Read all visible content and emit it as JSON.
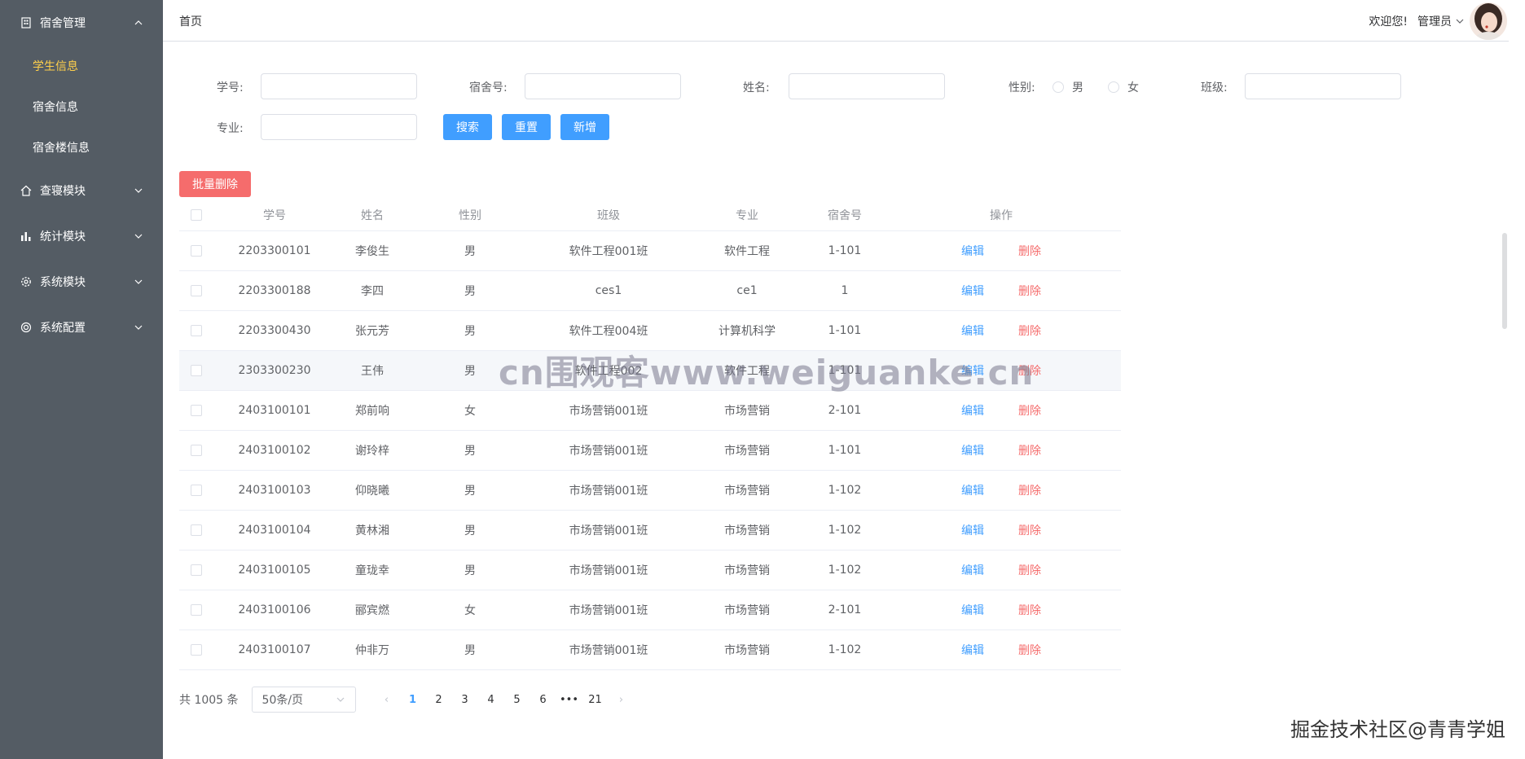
{
  "sidebar": {
    "groups": [
      {
        "label": "宿舍管理",
        "icon": "building-icon",
        "expanded": true,
        "children": [
          {
            "label": "学生信息",
            "active": true
          },
          {
            "label": "宿舍信息",
            "active": false
          },
          {
            "label": "宿舍楼信息",
            "active": false
          }
        ]
      },
      {
        "label": "查寝模块",
        "icon": "home-icon",
        "expanded": false
      },
      {
        "label": "统计模块",
        "icon": "bar-chart-icon",
        "expanded": false
      },
      {
        "label": "系统模块",
        "icon": "gear-icon",
        "expanded": false
      },
      {
        "label": "系统配置",
        "icon": "lifebuoy-icon",
        "expanded": false
      }
    ]
  },
  "header": {
    "breadcrumb": "首页",
    "greeting": "欢迎您!",
    "user": "管理员"
  },
  "search": {
    "student_id_label": "学号:",
    "dorm_no_label": "宿舍号:",
    "name_label": "姓名:",
    "gender_label": "性别:",
    "gender_male": "男",
    "gender_female": "女",
    "class_label": "班级:",
    "major_label": "专业:",
    "search_btn": "搜索",
    "reset_btn": "重置",
    "add_btn": "新增"
  },
  "batch_delete": "批量删除",
  "table": {
    "headers": [
      "学号",
      "姓名",
      "性别",
      "班级",
      "专业",
      "宿舍号",
      "操作"
    ],
    "edit_label": "编辑",
    "delete_label": "删除",
    "rows": [
      [
        "2203300101",
        "李俊生",
        "男",
        "软件工程001班",
        "软件工程",
        "1-101"
      ],
      [
        "2203300188",
        "李四",
        "男",
        "ces1",
        "ce1",
        "1"
      ],
      [
        "2203300430",
        "张元芳",
        "男",
        "软件工程004班",
        "计算机科学",
        "1-101"
      ],
      [
        "2303300230",
        "王伟",
        "男",
        "软件工程002",
        "软件工程",
        "1-101"
      ],
      [
        "2403100101",
        "郑前响",
        "女",
        "市场营销001班",
        "市场营销",
        "2-101"
      ],
      [
        "2403100102",
        "谢玲梓",
        "男",
        "市场营销001班",
        "市场营销",
        "1-101"
      ],
      [
        "2403100103",
        "仰晓曦",
        "男",
        "市场营销001班",
        "市场营销",
        "1-102"
      ],
      [
        "2403100104",
        "黄林湘",
        "男",
        "市场营销001班",
        "市场营销",
        "1-102"
      ],
      [
        "2403100105",
        "童珑幸",
        "男",
        "市场营销001班",
        "市场营销",
        "1-102"
      ],
      [
        "2403100106",
        "郦宾燃",
        "女",
        "市场营销001班",
        "市场营销",
        "2-101"
      ],
      [
        "2403100107",
        "仲非万",
        "男",
        "市场营销001班",
        "市场营销",
        "1-102"
      ]
    ]
  },
  "pagination": {
    "total": "共 1005 条",
    "page_size": "50条/页",
    "pages": [
      "1",
      "2",
      "3",
      "4",
      "5",
      "6",
      "•••",
      "21"
    ],
    "current": "1"
  },
  "watermark": "cn围观客www.weiguanke.cn",
  "corner_watermark": "掘金技术社区@青青学姐",
  "colors": {
    "sidebar_bg": "#545c64",
    "active_menu": "#ffd04b",
    "primary": "#409eff",
    "danger": "#f56c6c"
  }
}
